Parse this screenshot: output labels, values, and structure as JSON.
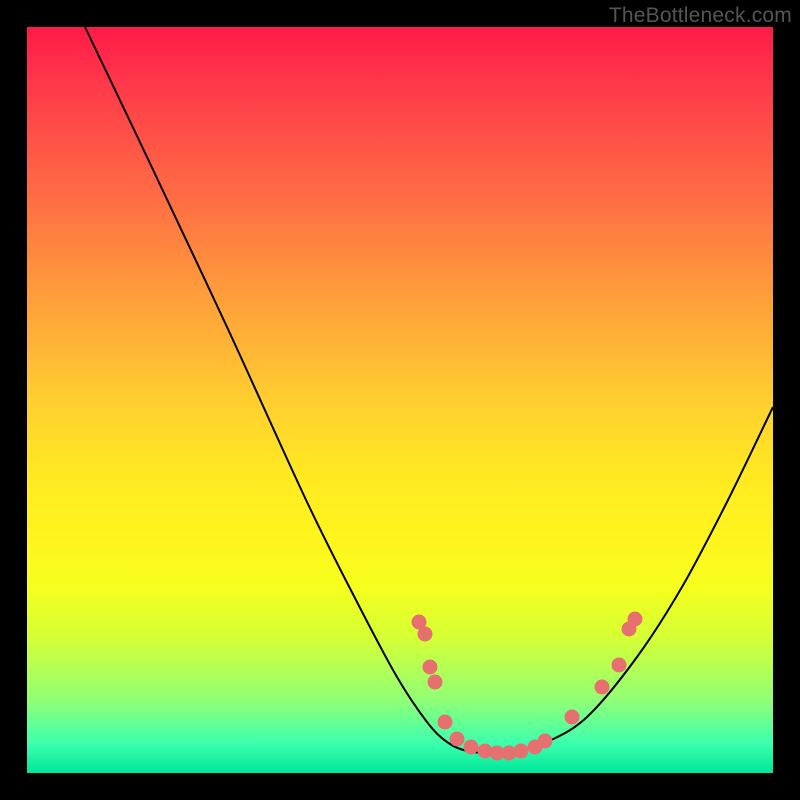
{
  "watermark": "TheBottleneck.com",
  "chart_data": {
    "type": "line",
    "title": "",
    "xlabel": "",
    "ylabel": "",
    "xrange": [
      0,
      746
    ],
    "yrange": [
      0,
      746
    ],
    "curve_points": [
      [
        58,
        0
      ],
      [
        120,
        130
      ],
      [
        200,
        300
      ],
      [
        280,
        475
      ],
      [
        330,
        575
      ],
      [
        370,
        650
      ],
      [
        400,
        695
      ],
      [
        420,
        715
      ],
      [
        440,
        724
      ],
      [
        465,
        726
      ],
      [
        490,
        724
      ],
      [
        520,
        715
      ],
      [
        560,
        690
      ],
      [
        610,
        630
      ],
      [
        655,
        560
      ],
      [
        700,
        475
      ],
      [
        746,
        380
      ]
    ],
    "dots": [
      [
        392,
        595
      ],
      [
        398,
        607
      ],
      [
        403,
        640
      ],
      [
        408,
        655
      ],
      [
        418,
        695
      ],
      [
        430,
        712
      ],
      [
        444,
        720
      ],
      [
        458,
        724
      ],
      [
        470,
        726
      ],
      [
        482,
        726
      ],
      [
        494,
        724
      ],
      [
        508,
        720
      ],
      [
        518,
        714
      ],
      [
        545,
        690
      ],
      [
        575,
        660
      ],
      [
        592,
        638
      ],
      [
        602,
        602
      ],
      [
        608,
        592
      ]
    ]
  }
}
